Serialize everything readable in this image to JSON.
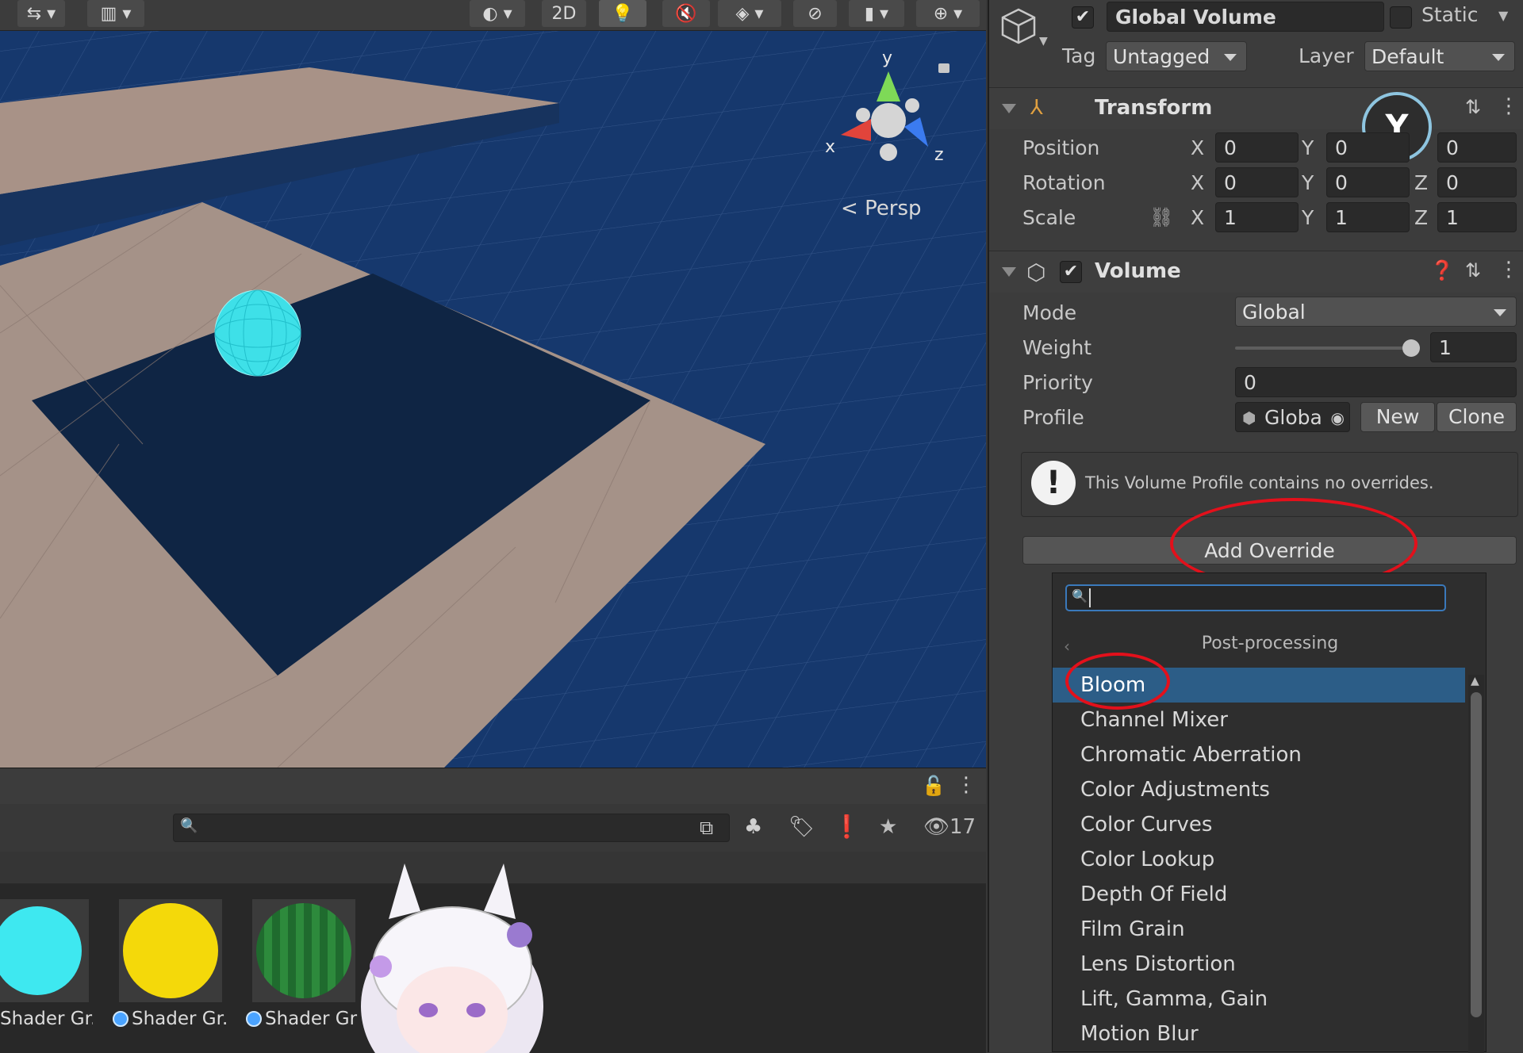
{
  "scene": {
    "toolbar": {
      "mode_2d": "2D"
    },
    "gizmo": {
      "y": "y",
      "x": "x",
      "z": "z"
    },
    "persp_label": "Persp"
  },
  "project": {
    "visible_count": "17",
    "assets": [
      {
        "label": "Shader Gr...",
        "color": "#3ee8f0"
      },
      {
        "label": "Shader Gr...",
        "color": "#f4d90a"
      },
      {
        "label": "Shader Gr",
        "color": "#1f6b2e"
      }
    ]
  },
  "inspector": {
    "object_name": "Global Volume",
    "static_label": "Static",
    "tag_label": "Tag",
    "tag_value": "Untagged",
    "layer_label": "Layer",
    "layer_value": "Default",
    "transform": {
      "title": "Transform",
      "position": {
        "label": "Position",
        "x": "0",
        "y": "0",
        "z": "0"
      },
      "rotation": {
        "label": "Rotation",
        "x": "0",
        "y": "0",
        "z": "0"
      },
      "scale": {
        "label": "Scale",
        "x": "1",
        "y": "1",
        "z": "1"
      },
      "axis_x": "X",
      "axis_y": "Y",
      "axis_z": "Z"
    },
    "volume": {
      "title": "Volume",
      "mode_label": "Mode",
      "mode_value": "Global",
      "weight_label": "Weight",
      "weight_value": "1",
      "priority_label": "Priority",
      "priority_value": "0",
      "profile_label": "Profile",
      "profile_value": "Globa",
      "new_button": "New",
      "clone_button": "Clone",
      "info_message": "This Volume Profile contains no overrides.",
      "add_override": "Add Override"
    }
  },
  "popup": {
    "search_placeholder": "",
    "category": "Post-processing",
    "items": [
      "Bloom",
      "Channel Mixer",
      "Chromatic Aberration",
      "Color Adjustments",
      "Color Curves",
      "Color Lookup",
      "Depth Of Field",
      "Film Grain",
      "Lens Distortion",
      "Lift, Gamma, Gain",
      "Motion Blur"
    ],
    "selected": "Bloom"
  },
  "colors": {
    "selection": "#2c5d87",
    "annotation_red": "#e3101b",
    "scene_sky": "#153567",
    "floor": "#a59288"
  }
}
